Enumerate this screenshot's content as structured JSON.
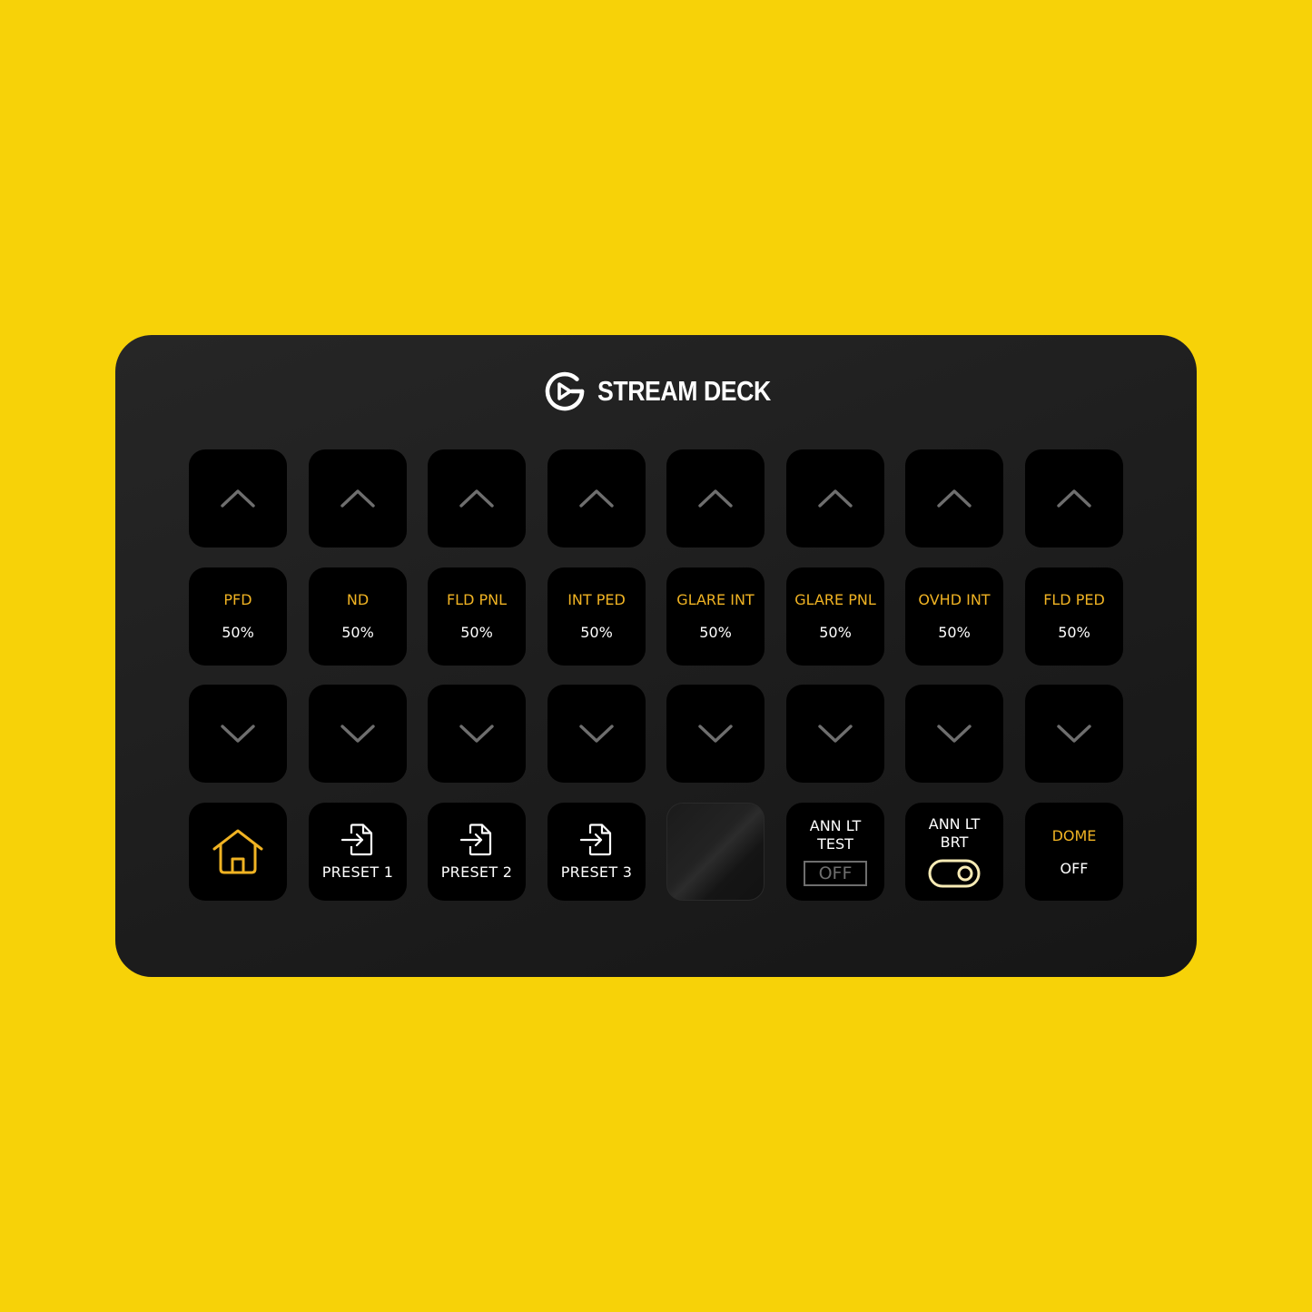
{
  "device": {
    "brand": "STREAM DECK",
    "logo_icon": "elgato-logo-icon"
  },
  "colors": {
    "background": "#F7D208",
    "accent": "#F0B323",
    "arrow": "#6e6e6e",
    "toggle": "#F7EBB5"
  },
  "up_row": [
    {
      "icon": "chevron-up-icon",
      "target": "PFD"
    },
    {
      "icon": "chevron-up-icon",
      "target": "ND"
    },
    {
      "icon": "chevron-up-icon",
      "target": "FLD PNL"
    },
    {
      "icon": "chevron-up-icon",
      "target": "INT PED"
    },
    {
      "icon": "chevron-up-icon",
      "target": "GLARE INT"
    },
    {
      "icon": "chevron-up-icon",
      "target": "GLARE PNL"
    },
    {
      "icon": "chevron-up-icon",
      "target": "OVHD INT"
    },
    {
      "icon": "chevron-up-icon",
      "target": "FLD PED"
    }
  ],
  "value_row": [
    {
      "label": "PFD",
      "value": "50%"
    },
    {
      "label": "ND",
      "value": "50%"
    },
    {
      "label": "FLD PNL",
      "value": "50%"
    },
    {
      "label": "INT PED",
      "value": "50%"
    },
    {
      "label": "GLARE INT",
      "value": "50%"
    },
    {
      "label": "GLARE PNL",
      "value": "50%"
    },
    {
      "label": "OVHD INT",
      "value": "50%"
    },
    {
      "label": "FLD PED",
      "value": "50%"
    }
  ],
  "down_row": [
    {
      "icon": "chevron-down-icon"
    },
    {
      "icon": "chevron-down-icon"
    },
    {
      "icon": "chevron-down-icon"
    },
    {
      "icon": "chevron-down-icon"
    },
    {
      "icon": "chevron-down-icon"
    },
    {
      "icon": "chevron-down-icon"
    },
    {
      "icon": "chevron-down-icon"
    },
    {
      "icon": "chevron-down-icon"
    }
  ],
  "bottom_row": {
    "home": {
      "icon": "home-icon"
    },
    "presets": [
      {
        "label": "PRESET 1",
        "icon": "file-import-icon"
      },
      {
        "label": "PRESET 2",
        "icon": "file-import-icon"
      },
      {
        "label": "PRESET 3",
        "icon": "file-import-icon"
      }
    ],
    "blank": {},
    "ann_lt_test": {
      "line1": "ANN LT",
      "line2": "TEST",
      "state": "OFF"
    },
    "ann_lt_brt": {
      "line1": "ANN LT",
      "line2": "BRT",
      "toggle_on": true
    },
    "dome": {
      "label": "DOME",
      "value": "OFF"
    }
  }
}
